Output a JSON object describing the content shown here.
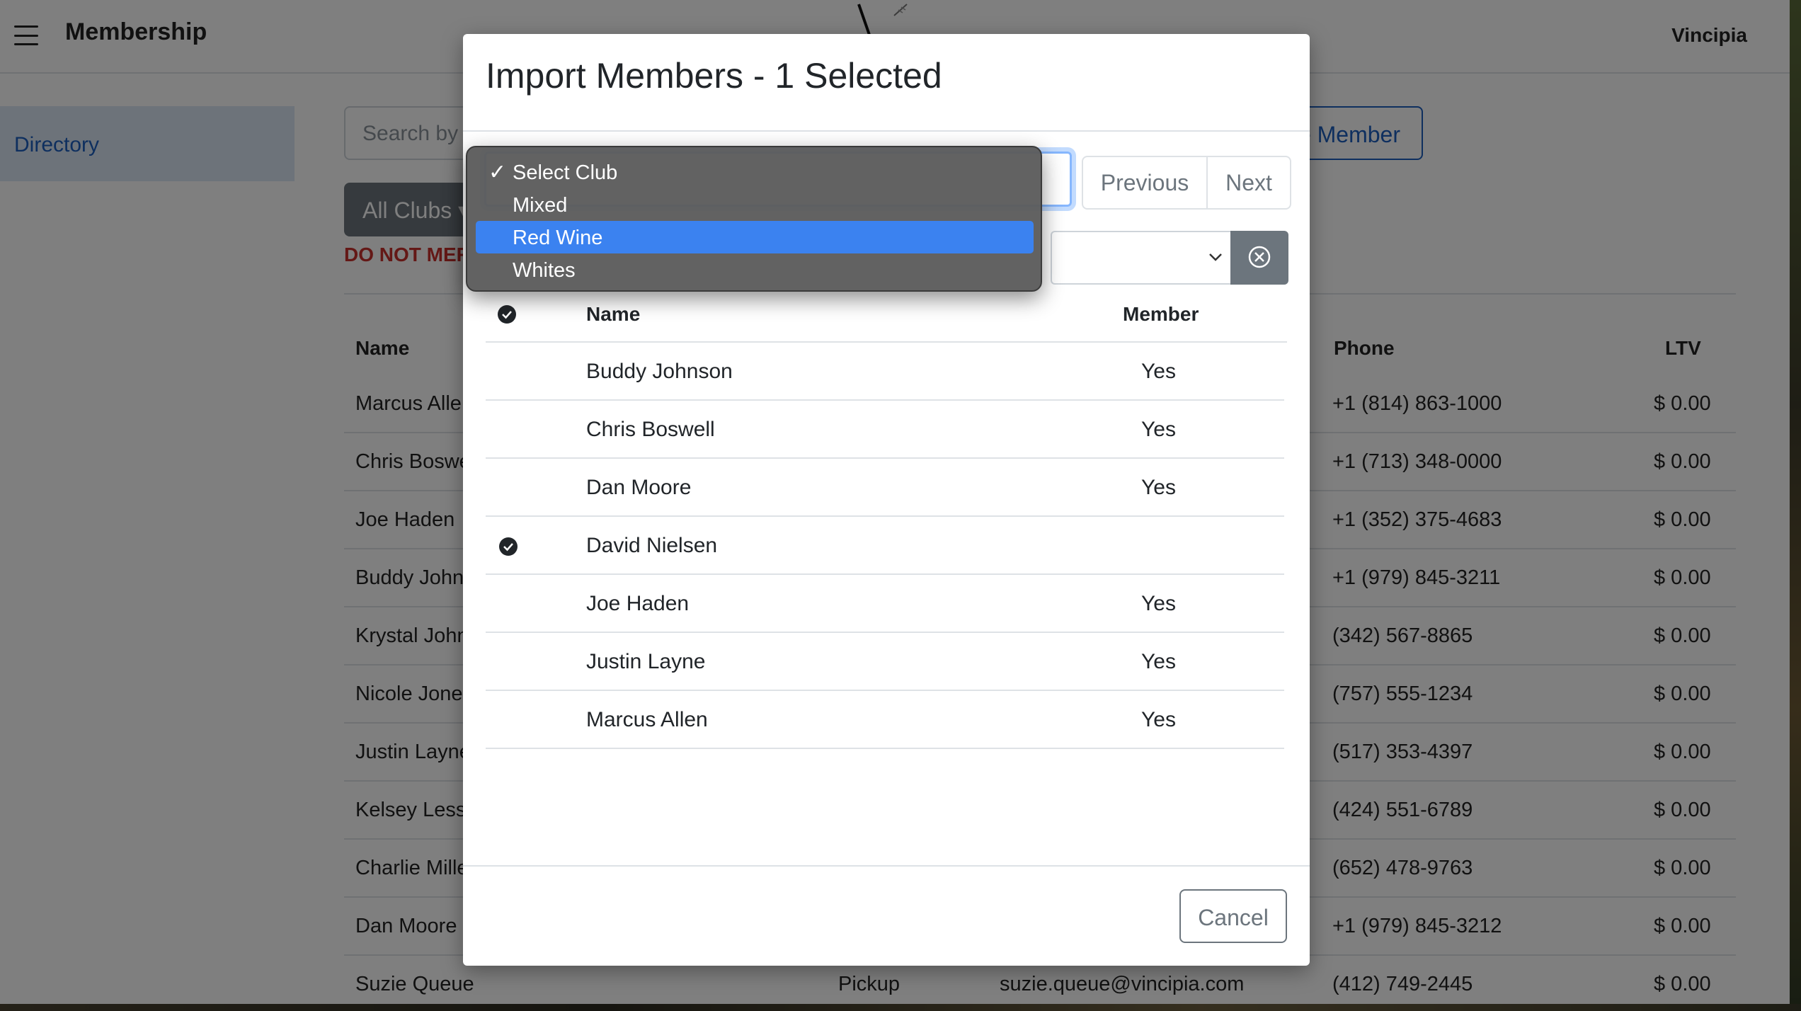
{
  "app": {
    "title": "Membership",
    "brand": "Vincipia"
  },
  "sidebar": {
    "items": [
      {
        "label": "Directory"
      }
    ]
  },
  "toolbar": {
    "search_placeholder": "Search by L",
    "add_member_label": "e Member",
    "clubs_label": "All Clubs ▾",
    "warning": "DO NOT MER"
  },
  "table": {
    "headers": {
      "name": "Name",
      "phone": "Phone",
      "ltv": "LTV"
    },
    "rows": [
      {
        "name": "Marcus Alle",
        "phone": "+1 (814) 863-1000",
        "ltv": "$ 0.00"
      },
      {
        "name": "Chris Boswe",
        "phone": "+1 (713) 348-0000",
        "ltv": "$ 0.00"
      },
      {
        "name": "Joe Haden",
        "phone": "+1 (352) 375-4683",
        "ltv": "$ 0.00"
      },
      {
        "name": "Buddy John",
        "phone": "+1 (979) 845-3211",
        "ltv": "$ 0.00"
      },
      {
        "name": "Krystal John",
        "phone": "(342) 567-8865",
        "ltv": "$ 0.00"
      },
      {
        "name": "Nicole Jone",
        "phone": "(757) 555-1234",
        "ltv": "$ 0.00"
      },
      {
        "name": "Justin Layne",
        "phone": "(517) 353-4397",
        "ltv": "$ 0.00"
      },
      {
        "name": "Kelsey Less",
        "phone": "(424) 551-6789",
        "ltv": "$ 0.00"
      },
      {
        "name": "Charlie Mille",
        "phone": "(652) 478-9763",
        "ltv": "$ 0.00"
      },
      {
        "name": "Dan Moore",
        "phone": "+1 (979) 845-3212",
        "ltv": "$ 0.00"
      },
      {
        "name": "Suzie Queue",
        "delivery": "Pickup",
        "email": "suzie.queue@vincipia.com",
        "phone": "(412) 749-2445",
        "ltv": "$ 0.00"
      }
    ]
  },
  "modal": {
    "title": "Import Members - 1 Selected",
    "previous_label": "Previous",
    "next_label": "Next",
    "headers": {
      "name": "Name",
      "member": "Member"
    },
    "rows": [
      {
        "name": "Buddy Johnson",
        "member": "Yes",
        "selected": false
      },
      {
        "name": "Chris Boswell",
        "member": "Yes",
        "selected": false
      },
      {
        "name": "Dan Moore",
        "member": "Yes",
        "selected": false
      },
      {
        "name": "David Nielsen",
        "member": "",
        "selected": true
      },
      {
        "name": "Joe Haden",
        "member": "Yes",
        "selected": false
      },
      {
        "name": "Justin Layne",
        "member": "Yes",
        "selected": false
      },
      {
        "name": "Marcus Allen",
        "member": "Yes",
        "selected": false
      }
    ],
    "cancel_label": "Cancel"
  },
  "dropdown": {
    "options": [
      {
        "label": "Select Club",
        "checked": true,
        "highlighted": false
      },
      {
        "label": "Mixed",
        "checked": false,
        "highlighted": false
      },
      {
        "label": "Red Wine",
        "checked": false,
        "highlighted": true
      },
      {
        "label": "Whites",
        "checked": false,
        "highlighted": false
      }
    ],
    "check_glyph": "✓"
  },
  "colors": {
    "accent": "#1d5fbf",
    "warning": "#c9302c",
    "highlight": "#3b82f0"
  }
}
